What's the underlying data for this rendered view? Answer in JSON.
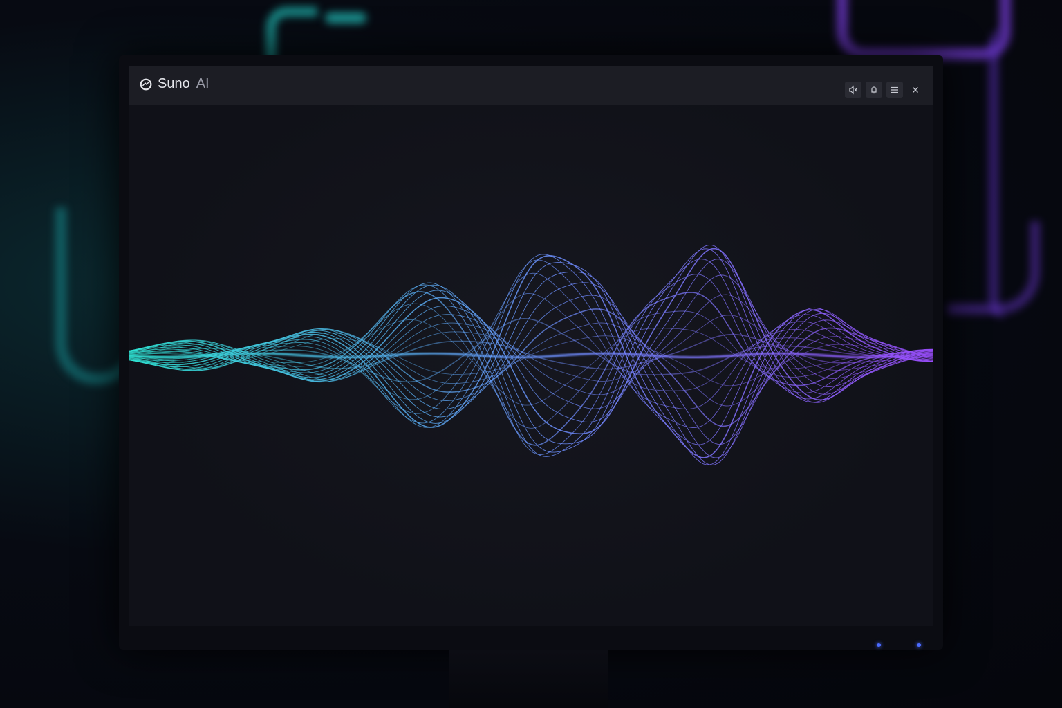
{
  "app": {
    "brand_name": "Suno",
    "brand_suffix": "AI"
  },
  "window_controls": [
    {
      "name": "mute-button",
      "icon": "speaker-mute-icon"
    },
    {
      "name": "notifications-button",
      "icon": "bell-icon"
    },
    {
      "name": "menu-button",
      "icon": "hamburger-icon"
    },
    {
      "name": "close-button",
      "icon": "close-icon"
    }
  ],
  "visualizer": {
    "colors": {
      "start": "#2ee6d6",
      "middle": "#6f8cff",
      "end": "#9b4dff"
    }
  }
}
